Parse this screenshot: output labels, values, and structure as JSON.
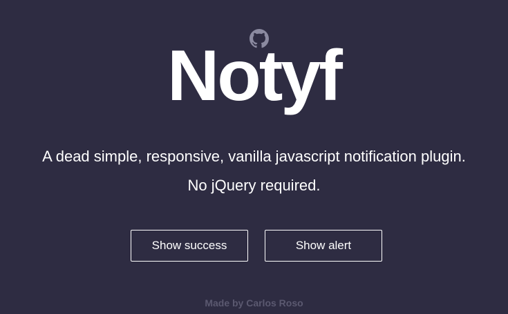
{
  "header": {
    "github_icon": "github-icon",
    "title": "Notyf"
  },
  "tagline": {
    "line1": "A dead simple, responsive, vanilla javascript notification plugin.",
    "line2": "No jQuery required."
  },
  "buttons": {
    "success_label": "Show success",
    "alert_label": "Show alert"
  },
  "footer": {
    "credit": "Made by Carlos Roso"
  },
  "colors": {
    "background": "#2e2c42",
    "text": "#ffffff",
    "icon": "#8b8aa0",
    "footer": "#5b5970"
  }
}
